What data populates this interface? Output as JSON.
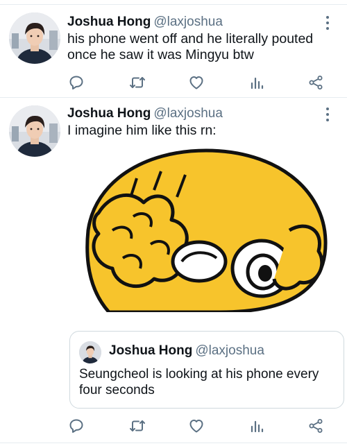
{
  "tweets": [
    {
      "name": "Joshua Hong",
      "handle": "@laxjoshua",
      "text_line1": "his phone went off and he literally pouted",
      "text_line2": "once he saw it was Mingyu btw"
    },
    {
      "name": "Joshua Hong",
      "handle": "@laxjoshua",
      "text_line1": "I imagine him like this rn:",
      "quote": {
        "name": "Joshua Hong",
        "handle": "@laxjoshua",
        "text_line1": "Seungcheol is looking at his phone every",
        "text_line2": "four seconds"
      }
    }
  ],
  "icons": {
    "reply": "reply-icon",
    "retweet": "retweet-icon",
    "like": "heart-icon",
    "analytics": "analytics-icon",
    "share": "share-icon",
    "more": "more-vertical-icon"
  },
  "colors": {
    "text": "#0f1419",
    "secondary": "#5b7083",
    "icon": "#5b7083",
    "divider": "#e6ecf0",
    "emoji_yellow": "#f7c42c"
  }
}
